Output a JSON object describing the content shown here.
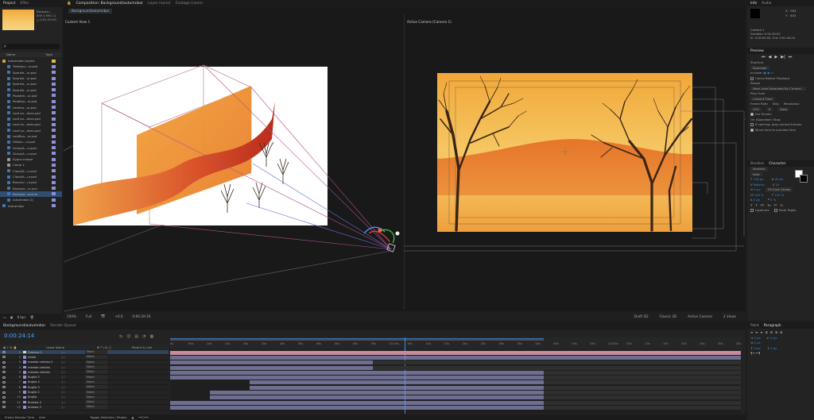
{
  "project": {
    "tabs": [
      "Project",
      "Effec"
    ],
    "thumb_info": [
      "Backgro...",
      "830 x 561 (1",
      "△ 0:01:45:00"
    ],
    "search_placeholder": "ρ.",
    "col_name": "Name",
    "col_type": "Type",
    "items": [
      "Autumnba Layers",
      "Trees/au...ur.psd",
      "Sparkle...ur.psd",
      "Sparkle...ur.psd",
      "Sparkle...ur.psd",
      "Sparkle...ur.psd",
      "Poplatin...ur.psd",
      "Poddlau...ur.psd",
      "Leafrou...ur.psd",
      "Leaf ou...dues.psd",
      "Leaf ou...dues.psd",
      "Leaf ou...dues.psd",
      "Leaf ou...dues.psd",
      "Leafflou...ur.psd",
      "Hillsbu...ur.psd",
      "Grass/A...ur.psd",
      "Grass/A...ur.psd",
      "Sygna masze",
      "Camp 1",
      "Cloud/A...ur.psd",
      "Cloud/A...ur.psd",
      "Branch/...ur.psd",
      "Backgro...ur.psd",
      "Backgro...autum",
      "Autumnba (1)",
      "Autumnba"
    ],
    "footer": [
      "8 bpc"
    ]
  },
  "comp": {
    "tabs": [
      "Composition: Background/autumnbar",
      "Layer (none)",
      "Footage (none)"
    ],
    "breadcrumb": "Background/autumnbar",
    "left_view": "Custom View 1",
    "right_view": "Active Camera (Camera 1)",
    "footer_left": [
      "100%",
      "Full",
      "+0.0",
      "0:00:29:16"
    ],
    "footer_right": [
      "Draft 3D",
      "Classic 3D",
      "Active Camera",
      "2 Views"
    ]
  },
  "info": {
    "tabs": [
      "Info",
      "Audio"
    ],
    "coords": [
      "X : 563",
      "Y : 445"
    ],
    "lines": [
      "Camera 1",
      "Duration: 0:01:45:00",
      "In: 0:00:00:00, Out: 0:01:44:24"
    ]
  },
  "preview": {
    "title": "Preview",
    "shortcut_label": "Shortcut",
    "shortcut_value": "Spacebar",
    "include_label": "Include:",
    "cache_label": "Cache Before Playback",
    "range_label": "Range",
    "range_value": "Work Area Extended By Current...",
    "playfrom_label": "Play From",
    "playfrom_value": "Current Time",
    "fr_labels": [
      "Frame Rate",
      "Skip",
      "Resolution"
    ],
    "fr_values": [
      "(25)",
      "0",
      "Auto"
    ],
    "fullscreen": "Full Screen",
    "onstop_label": "On (Spacebar) Stop:",
    "onstop1": "If caching, play cached frames",
    "onstop2": "Move time to preview time"
  },
  "character": {
    "tabs": [
      "Brushes",
      "Character"
    ],
    "font": "Verdana",
    "style": "Italic",
    "size": "106 px",
    "leading": "45 px",
    "kerning": "Metrics",
    "tracking": "25",
    "stroke": "0 px",
    "stroke_mode": "Fill Over Stroke",
    "vscale": "100 %",
    "hscale": "100 %",
    "baseline": "0 px",
    "tsume": "0 %",
    "ligatures": "Ligatures",
    "hindi": "Hindi Digits"
  },
  "timeline": {
    "tabs": [
      "Background/autumnbar",
      "Render Queue"
    ],
    "timecode": "0:00:24:14",
    "col_name": "Layer Name",
    "col_parent": "Parent & Link",
    "layers": [
      {
        "n": "1",
        "name": "Camera 1",
        "parent": "None"
      },
      {
        "n": "2",
        "name": "niebo",
        "parent": "None"
      },
      {
        "n": "3",
        "name": "mewda ziemka 2",
        "parent": "None"
      },
      {
        "n": "4",
        "name": "mewda ziemka",
        "parent": "None"
      },
      {
        "n": "5",
        "name": "mewda ziemka",
        "parent": "None"
      },
      {
        "n": "6",
        "name": "Kuglia 5",
        "parent": "None"
      },
      {
        "n": "7",
        "name": "Kuglia 4",
        "parent": "None"
      },
      {
        "n": "8",
        "name": "Kuglia 3",
        "parent": "None"
      },
      {
        "n": "9",
        "name": "Kuglia 2",
        "parent": "None"
      },
      {
        "n": "10",
        "name": "Kuglia",
        "parent": "None"
      },
      {
        "n": "11",
        "name": "drzewo 4",
        "parent": "None"
      },
      {
        "n": "12",
        "name": "drzewo 3",
        "parent": "None"
      }
    ],
    "ruler": [
      "0s",
      "05s",
      "10s",
      "15s",
      "20s",
      "25s",
      "30s",
      "35s",
      "40s",
      "45s",
      "50s",
      "55s",
      "01:00s",
      "05s",
      "10s",
      "15s",
      "20s",
      "25s",
      "30s",
      "35s",
      "40s",
      "45s",
      "50s",
      "55s",
      "02:00s",
      "05s",
      "10s",
      "15s",
      "20s",
      "25s",
      "30s",
      "35s"
    ],
    "footer": [
      "Frame Render Time",
      "0ms",
      "Toggle Switches / Modes"
    ]
  },
  "paragraph": {
    "tabs": [
      "Paint",
      "Paragraph"
    ],
    "fields": [
      "0 px",
      "0 px",
      "0 px",
      "0 px",
      "0 px"
    ]
  }
}
